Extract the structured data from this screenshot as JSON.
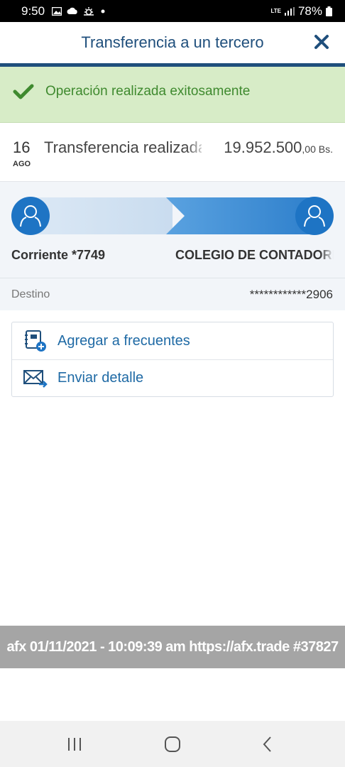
{
  "status_bar": {
    "time": "9:50",
    "network": "LTE",
    "battery": "78%",
    "icons": [
      "gallery-icon",
      "cloud-icon",
      "weather-icon",
      "dot-icon",
      "signal-icon",
      "battery-icon"
    ]
  },
  "header": {
    "title": "Transferencia a un tercero",
    "close_icon": "close-icon",
    "accent_color": "#1f4f7c"
  },
  "banner": {
    "message": "Operación realizada exitosamente",
    "icon": "check-icon",
    "color": "#3f8a2f",
    "background": "#d7ecc7"
  },
  "transaction": {
    "day": "16",
    "month": "AGO",
    "description": "Transferencia realizada",
    "amount_main": "19.952.500",
    "amount_decimals": ",00 Bs."
  },
  "transfer": {
    "origin_account": "Corriente *7749",
    "destination_name": "COLEGIO DE CONTADORES",
    "destination_label": "Destino",
    "destination_value": "************2906",
    "origin_icon": "user-icon",
    "destination_icon": "user-icon"
  },
  "actions": [
    {
      "label": "Agregar a frecuentes",
      "icon": "add-favorite-icon"
    },
    {
      "label": "Enviar detalle",
      "icon": "send-mail-icon"
    }
  ],
  "watermark": {
    "text": "afx 01/11/2021 - 10:09:39 am https://afx.trade #37827"
  },
  "nav_bar": {
    "icons": [
      "recent-apps-icon",
      "home-icon",
      "back-icon"
    ]
  }
}
